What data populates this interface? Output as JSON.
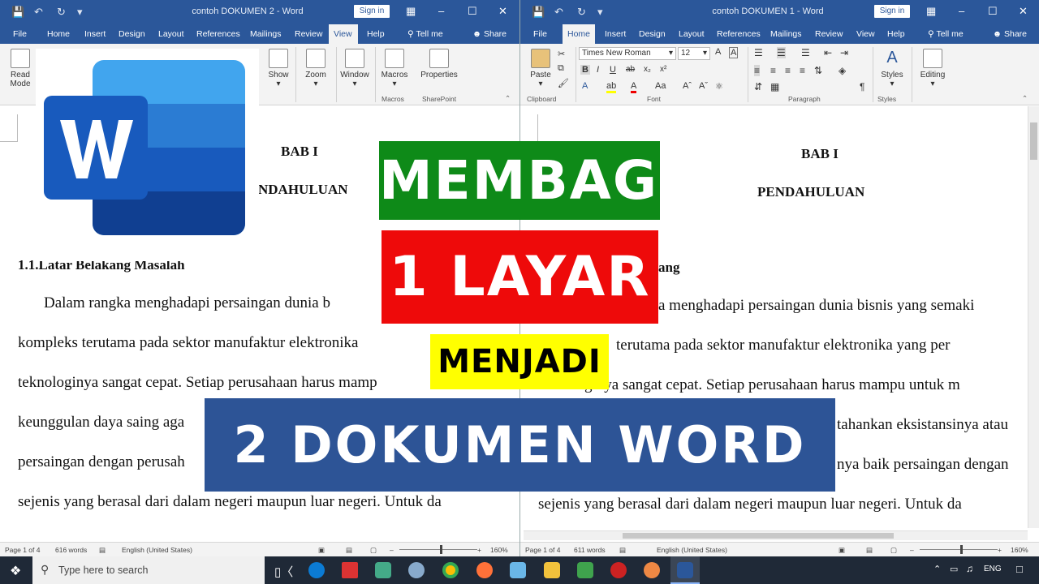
{
  "left": {
    "window_title": "contoh DOKUMEN 2 - Word",
    "signin": "Sign in",
    "tabs": [
      "File",
      "Home",
      "Insert",
      "Design",
      "Layout",
      "References",
      "Mailings",
      "Review",
      "View",
      "Help",
      "Tell me",
      "Share"
    ],
    "active_tab": "View",
    "ribbon": {
      "read_mode": "Read Mode",
      "show": "Show",
      "zoom": "Zoom",
      "window": "Window",
      "macros": "Macros",
      "properties": "Properties",
      "macros_group": "Macros",
      "sharepoint_group": "SharePoint"
    },
    "doc": {
      "bab": "BAB I",
      "title": "NDAHULUAN",
      "heading": "1.1.Latar Belakang Masalah",
      "lines": [
        "Dalam rangka menghadapi persaingan dunia b",
        "kompleks terutama pada sektor manufaktur elektronika",
        "teknologinya sangat cepat. Setiap perusahaan harus mamp",
        "keunggulan daya saing aga",
        "persaingan dengan perusah",
        "sejenis yang berasal dari dalam negeri maupun luar negeri. Untuk da"
      ]
    },
    "status": {
      "page": "Page 1 of 4",
      "words": "616 words",
      "lang": "English (United States)",
      "zoom": "160%"
    }
  },
  "right": {
    "window_title": "contoh DOKUMEN 1 - Word",
    "signin": "Sign in",
    "tabs": [
      "File",
      "Home",
      "Insert",
      "Design",
      "Layout",
      "References",
      "Mailings",
      "Review",
      "View",
      "Help",
      "Tell me",
      "Share"
    ],
    "active_tab": "Home",
    "ribbon": {
      "paste": "Paste",
      "clipboard": "Clipboard",
      "font_name": "Times New Roman",
      "font_size": "12",
      "font_group": "Font",
      "paragraph_group": "Paragraph",
      "styles": "Styles",
      "styles_group": "Styles",
      "editing": "Editing"
    },
    "doc": {
      "bab": "BAB I",
      "title": "PENDAHULUAN",
      "heading_tail": "ang",
      "lines": [
        "a menghadapi persaingan dunia bisnis yang semaki",
        "terutama pada sektor manufaktur elektronika yang per",
        "teknologinya sangat cepat. Setiap perusahaan harus mampu untuk m",
        "tahankan eksistansinya atau",
        "nya baik persaingan dengan",
        "sejenis yang berasal dari dalam negeri maupun luar negeri. Untuk da"
      ]
    },
    "status": {
      "page": "Page 1 of 4",
      "words": "611 words",
      "lang": "English (United States)",
      "zoom": "160%"
    }
  },
  "taskbar": {
    "search_placeholder": "Type here to search",
    "lang": "ENG"
  },
  "banners": {
    "line1": "MEMBAGI",
    "line2": "1 LAYAR",
    "line3": "MENJADI",
    "line4": "2 DOKUMEN WORD"
  },
  "colors": {
    "word_blue": "#2b579a",
    "banner_green": "#0e8a18",
    "banner_red": "#ee0a0a",
    "banner_yellow": "#ffff00",
    "banner_navy": "#2d5496"
  }
}
